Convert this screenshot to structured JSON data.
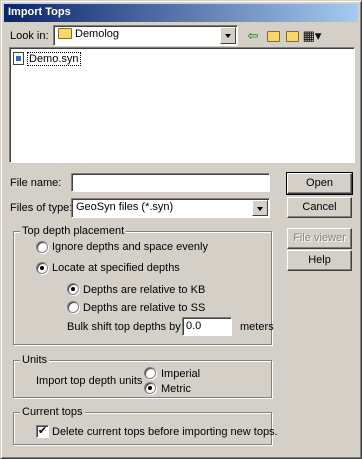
{
  "window": {
    "title": "Import Tops"
  },
  "lookin": {
    "label": "Look in:",
    "value": "Demolog"
  },
  "toolbar": {
    "back_icon": "back-arrow-icon",
    "up_icon": "up-folder-icon",
    "new_folder_icon": "new-folder-icon",
    "view_icon": "view-menu-icon"
  },
  "files": [
    {
      "name": "Demo.syn",
      "icon": "file-icon"
    }
  ],
  "filename": {
    "label": "File name:",
    "value": ""
  },
  "filetype": {
    "label": "Files of type:",
    "value": "GeoSyn files (*.syn)"
  },
  "buttons": {
    "open": "Open",
    "cancel": "Cancel",
    "file_viewer": "File viewer",
    "help": "Help"
  },
  "placement": {
    "title": "Top depth placement",
    "ignore": "Ignore depths and space evenly",
    "locate": "Locate at specified depths",
    "rel_kb": "Depths are relative to KB",
    "rel_ss": "Depths are relative to SS",
    "shift_label": "Bulk shift top depths by + -",
    "shift_value": "0.0",
    "shift_unit": "meters",
    "selected_mode": "locate",
    "selected_relative": "kb"
  },
  "units": {
    "title": "Units",
    "label": "Import top depth units",
    "imperial": "Imperial",
    "metric": "Metric",
    "selected": "metric"
  },
  "current": {
    "title": "Current tops",
    "delete_label": "Delete current tops before importing new tops.",
    "delete_checked": true
  },
  "colors": {
    "title_start": "#0a246a",
    "title_end": "#a6caf0",
    "face": "#d4d0c8"
  }
}
